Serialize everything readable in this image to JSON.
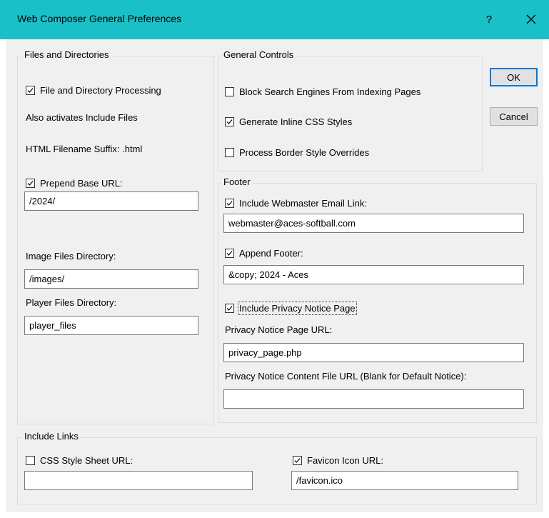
{
  "window": {
    "title": "Web Composer General Preferences",
    "help_label": "?",
    "accent_color": "#19c0c8"
  },
  "files": {
    "legend": "Files and Directories",
    "file_processing": {
      "label": "File and Directory Processing",
      "checked": true
    },
    "also_activates": "Also activates Include Files",
    "html_suffix": "HTML Filename Suffix: .html",
    "prepend_base": {
      "label": "Prepend Base URL:",
      "checked": true,
      "value": "/2024/"
    },
    "image_dir": {
      "label": "Image Files Directory:",
      "value": "/images/"
    },
    "player_dir": {
      "label": "Player Files Directory:",
      "value": "player_files"
    }
  },
  "general": {
    "legend": "General Controls",
    "block_search": {
      "label": "Block Search Engines From Indexing Pages",
      "checked": false
    },
    "inline_css": {
      "label": "Generate Inline CSS Styles",
      "checked": true
    },
    "border_override": {
      "label": "Process Border Style Overrides",
      "checked": false
    }
  },
  "buttons": {
    "ok": "OK",
    "cancel": "Cancel"
  },
  "footer": {
    "legend": "Footer",
    "webmaster": {
      "label": "Include Webmaster Email Link:",
      "checked": true,
      "value": "webmaster@aces-softball.com"
    },
    "append_footer": {
      "label": "Append Footer:",
      "checked": true,
      "value": "&copy; 2024 - Aces"
    },
    "privacy": {
      "label": "Include Privacy Notice Page",
      "checked": true
    },
    "privacy_url": {
      "label": "Privacy Notice Page URL:",
      "value": "privacy_page.php"
    },
    "privacy_content": {
      "label": "Privacy Notice Content File URL (Blank for Default Notice):",
      "value": ""
    }
  },
  "links": {
    "legend": "Include Links",
    "css": {
      "label": "CSS Style Sheet URL:",
      "checked": false,
      "value": ""
    },
    "favicon": {
      "label": "Favicon Icon URL:",
      "checked": true,
      "value": "/favicon.ico"
    }
  }
}
